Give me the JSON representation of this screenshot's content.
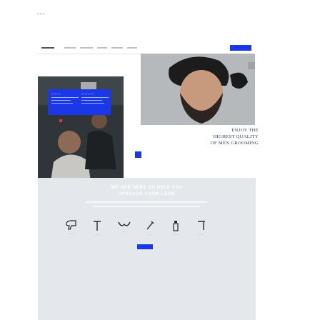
{
  "tagline": {
    "line1": "ENJOY THE",
    "line2": "HIGHEST QUALITY",
    "line3": "OF MEN GROOMING"
  },
  "band": {
    "title_line1": "WE ARE HERE TO HELP YOU",
    "title_line2": "UPGRADE YOUR LOOK"
  },
  "colors": {
    "accent": "#1a37e8",
    "band": "#e4e7ec",
    "tagline": "#2e3d52"
  },
  "icons": [
    "hair-dryer-icon",
    "comb-icon",
    "mustache-icon",
    "razor-icon",
    "bottle-icon",
    "scissors-icon"
  ]
}
